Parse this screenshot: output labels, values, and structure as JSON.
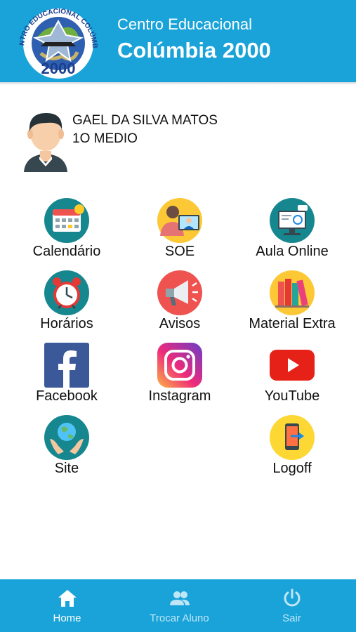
{
  "colors": {
    "header_bg": "#1aa3d9",
    "nav_active": "#ffffff",
    "nav_inactive": "#bfe6f6"
  },
  "header": {
    "logo_text_top": "CENTRO EDUCACIONAL COLÚMBIA",
    "logo_text_bottom": "2000",
    "subtitle": "Centro Educacional",
    "title": "Colúmbia 2000"
  },
  "student": {
    "name": "GAEL DA SILVA MATOS",
    "class": "1O MEDIO",
    "icon": "student-avatar-icon"
  },
  "menu": [
    {
      "label": "Calendário",
      "icon": "calendar-icon"
    },
    {
      "label": "SOE",
      "icon": "counseling-icon"
    },
    {
      "label": "Aula Online",
      "icon": "online-class-icon"
    },
    {
      "label": "Horários",
      "icon": "alarm-clock-icon"
    },
    {
      "label": "Avisos",
      "icon": "megaphone-icon"
    },
    {
      "label": "Material Extra",
      "icon": "books-icon"
    },
    {
      "label": "Facebook",
      "icon": "facebook-icon"
    },
    {
      "label": "Instagram",
      "icon": "instagram-icon"
    },
    {
      "label": "YouTube",
      "icon": "youtube-icon"
    },
    {
      "label": "Site",
      "icon": "globe-hands-icon"
    },
    {
      "label": "Logoff",
      "icon": "logoff-phone-icon"
    }
  ],
  "bottom_nav": [
    {
      "label": "Home",
      "icon": "home-icon",
      "active": true
    },
    {
      "label": "Trocar Aluno",
      "icon": "people-icon",
      "active": false
    },
    {
      "label": "Sair",
      "icon": "power-icon",
      "active": false
    }
  ]
}
